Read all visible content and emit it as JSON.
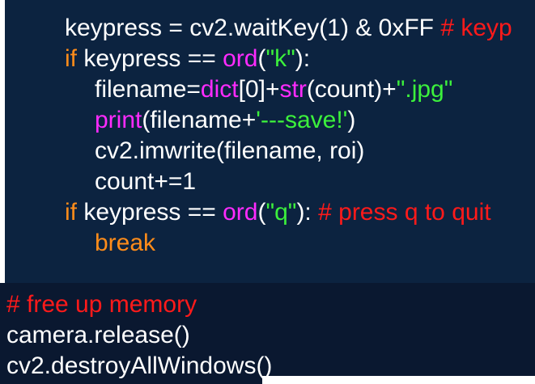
{
  "colors": {
    "background": "#0c2340",
    "keyword": "#ff8c1a",
    "builtin": "#ff2bff",
    "string": "#3cf03c",
    "comment": "#ff1a1a",
    "text": "#ffffff"
  },
  "code": {
    "line1": {
      "a": "keypress = cv2.waitKey(1) & 0xFF ",
      "comment": "# keyp"
    },
    "line2": {
      "kw": "if",
      "a": " keypress == ",
      "fn": "ord",
      "b": "(",
      "str": "\"k\"",
      "c": "):"
    },
    "line3": {
      "a": "filename=",
      "fn1": "dict",
      "b": "[0]+",
      "fn2": "str",
      "c": "(count)+",
      "str": "\".jpg\""
    },
    "line4": {
      "fn": "print",
      "a": "(filename+",
      "str": "'---save!'",
      "b": ")"
    },
    "line5": {
      "a": "cv2.imwrite(filename, roi)"
    },
    "line6": {
      "a": "count+=1"
    },
    "line7": {
      "kw": "if",
      "a": " keypress == ",
      "fn": "ord",
      "b": "(",
      "str": "\"q\"",
      "c": "): ",
      "comment": "# press q to quit"
    },
    "line8": {
      "kw": "break"
    },
    "line9": {
      "comment": "# free up memory"
    },
    "line10": {
      "a": "camera.release()"
    },
    "line11": {
      "a": "cv2.destroyAllWindows()"
    }
  }
}
